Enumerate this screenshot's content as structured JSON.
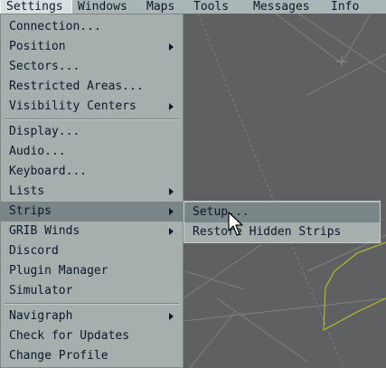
{
  "menubar": {
    "items": [
      "Settings",
      "Windows",
      "Maps",
      "Tools",
      "Messages",
      "Info"
    ]
  },
  "settings_menu": {
    "items": [
      {
        "label": "Connection...",
        "submenu": false
      },
      {
        "label": "Position",
        "submenu": true
      },
      {
        "label": "Sectors...",
        "submenu": false
      },
      {
        "label": "Restricted Areas...",
        "submenu": false
      },
      {
        "label": "Visibility Centers",
        "submenu": true
      },
      {
        "label": "Display...",
        "submenu": false
      },
      {
        "label": "Audio...",
        "submenu": false
      },
      {
        "label": "Keyboard...",
        "submenu": false
      },
      {
        "label": "Lists",
        "submenu": true
      },
      {
        "label": "Strips",
        "submenu": true
      },
      {
        "label": "GRIB Winds",
        "submenu": true
      },
      {
        "label": "Discord",
        "submenu": false
      },
      {
        "label": "Plugin Manager",
        "submenu": false
      },
      {
        "label": "Simulator",
        "submenu": false
      },
      {
        "label": "Navigraph",
        "submenu": true
      },
      {
        "label": "Check for Updates",
        "submenu": false
      },
      {
        "label": "Change Profile",
        "submenu": false
      }
    ]
  },
  "strips_submenu": {
    "items": [
      "Setup...",
      "Restore Hidden Strips"
    ]
  },
  "colors": {
    "radar_background": "#5e6062",
    "menu_background": "#a6aeae",
    "menu_highlight": "#7a8587",
    "sector_line": "#808285",
    "airspace_outline": "#c9c31e"
  },
  "icons": [
    "chevron-right-icon",
    "mouse-pointer-icon"
  ]
}
